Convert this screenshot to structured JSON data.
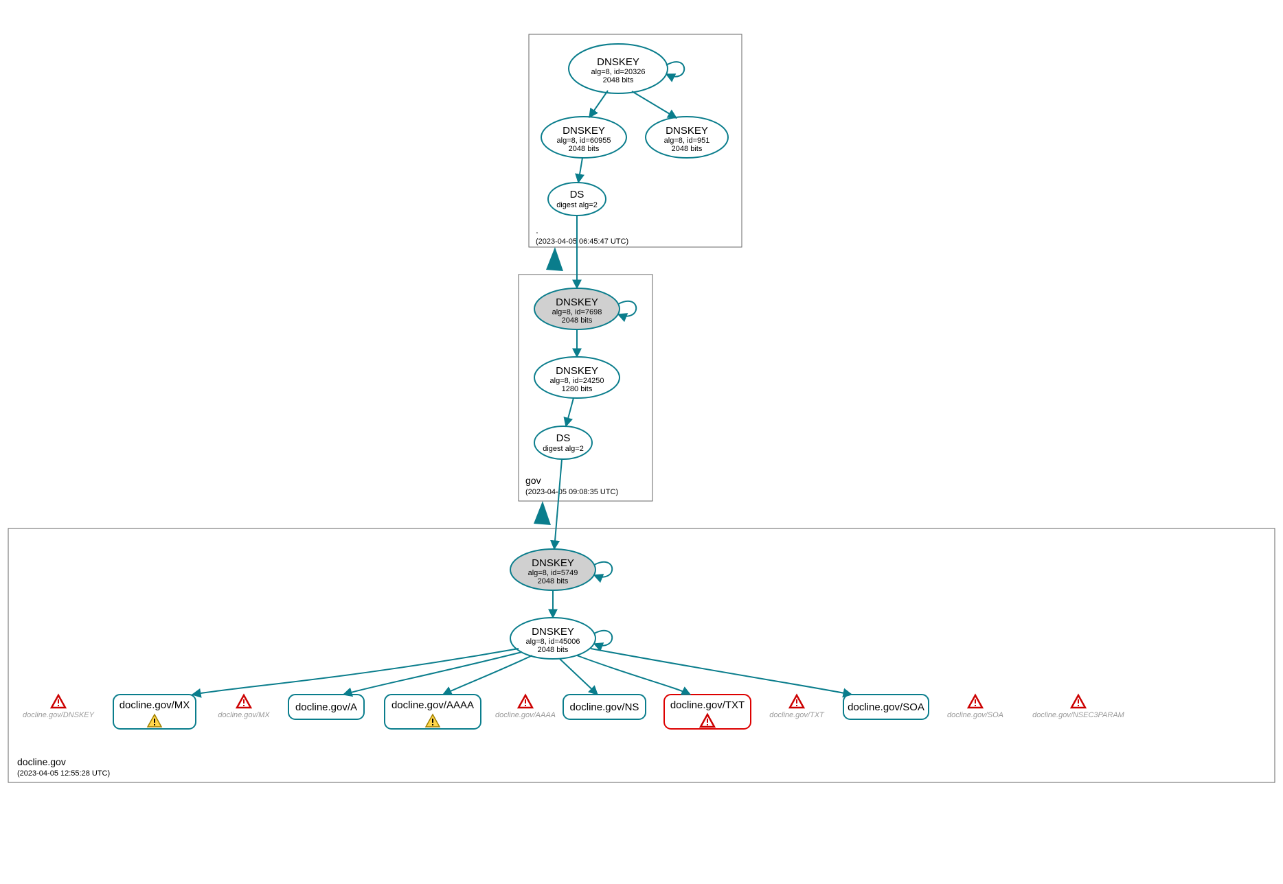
{
  "zones": {
    "root": {
      "label": ".",
      "timestamp": "(2023-04-05 06:45:47 UTC)"
    },
    "gov": {
      "label": "gov",
      "timestamp": "(2023-04-05 09:08:35 UTC)"
    },
    "docline": {
      "label": "docline.gov",
      "timestamp": "(2023-04-05 12:55:28 UTC)"
    }
  },
  "nodes": {
    "root_ksk": {
      "title": "DNSKEY",
      "line1": "alg=8, id=20326",
      "line2": "2048 bits"
    },
    "root_zsk1": {
      "title": "DNSKEY",
      "line1": "alg=8, id=60955",
      "line2": "2048 bits"
    },
    "root_zsk2": {
      "title": "DNSKEY",
      "line1": "alg=8, id=951",
      "line2": "2048 bits"
    },
    "root_ds": {
      "title": "DS",
      "line1": "digest alg=2",
      "line2": ""
    },
    "gov_ksk": {
      "title": "DNSKEY",
      "line1": "alg=8, id=7698",
      "line2": "2048 bits"
    },
    "gov_zsk": {
      "title": "DNSKEY",
      "line1": "alg=8, id=24250",
      "line2": "1280 bits"
    },
    "gov_ds": {
      "title": "DS",
      "line1": "digest alg=2",
      "line2": ""
    },
    "doc_ksk": {
      "title": "DNSKEY",
      "line1": "alg=8, id=5749",
      "line2": "2048 bits"
    },
    "doc_zsk": {
      "title": "DNSKEY",
      "line1": "alg=8, id=45006",
      "line2": "2048 bits"
    }
  },
  "rrsets": {
    "mx": "docline.gov/MX",
    "a": "docline.gov/A",
    "aaaa": "docline.gov/AAAA",
    "ns": "docline.gov/NS",
    "txt": "docline.gov/TXT",
    "soa": "docline.gov/SOA"
  },
  "unsigned": {
    "dnskey": "docline.gov/DNSKEY",
    "mx": "docline.gov/MX",
    "aaaa": "docline.gov/AAAA",
    "txt": "docline.gov/TXT",
    "soa": "docline.gov/SOA",
    "nsec3param": "docline.gov/NSEC3PARAM"
  }
}
